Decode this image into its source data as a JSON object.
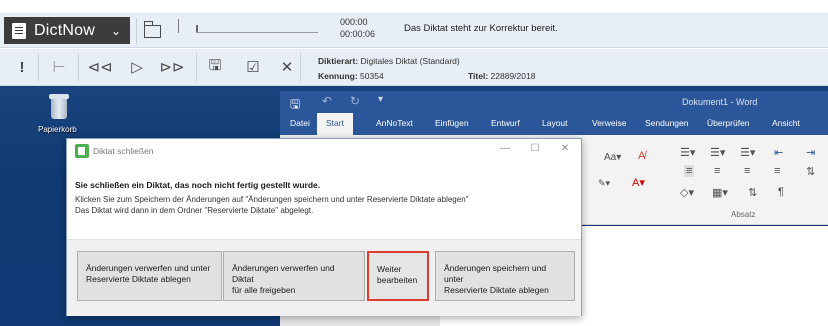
{
  "app": {
    "name": "DictNow",
    "time_elapsed": "000:00",
    "time_total": "00:00:06",
    "status_message": "Das Diktat steht zur Korrektur bereit."
  },
  "dictation": {
    "type_label": "Diktierart:",
    "type_value": "Digitales Diktat (Standard)",
    "id_label": "Kennung:",
    "id_value": "50354",
    "title_label": "Titel:",
    "title_value": "22889/2018"
  },
  "desktop": {
    "recycle_bin_label": "Papierkorb"
  },
  "word": {
    "document_title": "Dokument1 - Word",
    "tabs": [
      "Datei",
      "Start",
      "AnNoText",
      "Einfügen",
      "Entwurf",
      "Layout",
      "Verweise",
      "Sendungen",
      "Überprüfen",
      "Ansicht"
    ],
    "active_tab": "Start",
    "ribbon_group_label": "Absatz"
  },
  "dialog": {
    "title": "Diktat schließen",
    "heading": "Sie schließen ein Diktat, das noch nicht fertig gestellt wurde.",
    "line1": "Klicken Sie zum Speichern der Änderungen auf \"Änderungen speichern und unter Reservierte Diktate ablegen\"",
    "line2": "Das Diktat wird dann in dem Ordner \"Reservierte Diktate\" abgelegt.",
    "buttons": {
      "discard_reserved_l1": "Änderungen verwerfen und unter",
      "discard_reserved_l2": "Reservierte Diktate ablegen",
      "discard_release_l1": "Änderungen verwerfen und Diktat",
      "discard_release_l2": "für alle freigeben",
      "continue_l1": "Weiter",
      "continue_l2": "bearbeiten",
      "save_reserved_l1": "Änderungen speichern und unter",
      "save_reserved_l2": "Reservierte Diktate ablegen"
    }
  },
  "colors": {
    "word_blue": "#2b579a",
    "desktop_blue": "#103a76",
    "highlight_red": "#e03c2d",
    "dictnow_dark": "#3c3c3c"
  }
}
